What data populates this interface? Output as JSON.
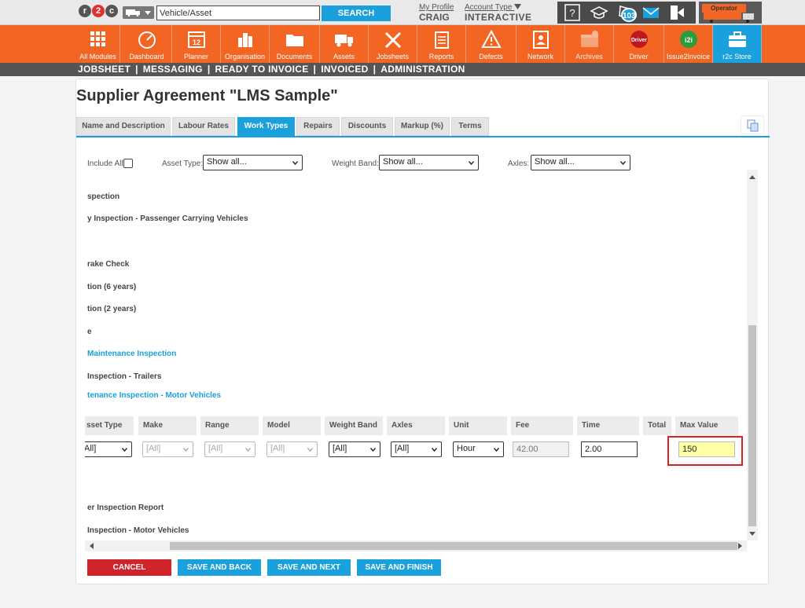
{
  "topbar": {
    "search_placeholder": "Vehicle/Asset",
    "search_button": "SEARCH",
    "profile_link": "My Profile",
    "profile_name": "CRAIG",
    "account_link": "Account Type",
    "account_value": "INTERACTIVE",
    "notification_count": "103",
    "operator_label": "Operator"
  },
  "modules": [
    {
      "label": "All Modules",
      "icon": "grid-icon"
    },
    {
      "label": "Dashboard",
      "icon": "speedometer-icon"
    },
    {
      "label": "Planner",
      "icon": "calendar-icon"
    },
    {
      "label": "Organisation",
      "icon": "building-icon"
    },
    {
      "label": "Documents",
      "icon": "folder-icon"
    },
    {
      "label": "Assets",
      "icon": "truck-icon"
    },
    {
      "label": "Jobsheets",
      "icon": "tools-icon"
    },
    {
      "label": "Reports",
      "icon": "clipboard-icon"
    },
    {
      "label": "Defects",
      "icon": "warning-icon"
    },
    {
      "label": "Network",
      "icon": "contacts-icon"
    },
    {
      "label": "Archives",
      "icon": "archive-icon"
    },
    {
      "label": "Driver",
      "icon": "driver-icon",
      "icon_text": "Driver"
    },
    {
      "label": "Issue2Invoice",
      "icon": "i2i-icon",
      "icon_text": "i2i"
    },
    {
      "label": "r2c Store",
      "icon": "briefcase-icon"
    }
  ],
  "nav": [
    "JOBSHEET",
    "MESSAGING",
    "READY TO INVOICE",
    "INVOICED",
    "ADMINISTRATION"
  ],
  "page": {
    "title": "Supplier Agreement \"LMS Sample\""
  },
  "tabs": [
    {
      "label": "Name and Description"
    },
    {
      "label": "Labour Rates"
    },
    {
      "label": "Work Types",
      "active": true
    },
    {
      "label": "Repairs"
    },
    {
      "label": "Discounts"
    },
    {
      "label": "Markup (%)"
    },
    {
      "label": "Terms"
    }
  ],
  "filters": {
    "include_all_label": "Include All",
    "asset_type_label": "Asset Type:",
    "asset_type_value": "Show all...",
    "weight_band_label": "Weight Band:",
    "weight_band_value": "Show all...",
    "axles_label": "Axles:",
    "axles_value": "Show all..."
  },
  "work_types": [
    {
      "text": "spection",
      "blue": false
    },
    {
      "text": "y Inspection - Passenger Carrying Vehicles",
      "blue": false
    },
    {
      "text": "rake Check",
      "blue": false
    },
    {
      "text": "tion (6 years)",
      "blue": false
    },
    {
      "text": "tion (2 years)",
      "blue": false
    },
    {
      "text": "e",
      "blue": false
    },
    {
      "text": "Maintenance Inspection",
      "blue": true
    },
    {
      "text": "Inspection - Trailers",
      "blue": false
    },
    {
      "text": "tenance Inspection - Motor Vehicles",
      "blue": true
    },
    {
      "text": "er Inspection Report",
      "blue": false
    },
    {
      "text": "Inspection - Motor Vehicles",
      "blue": false
    }
  ],
  "grid": {
    "headers": [
      "sset Type",
      "Make",
      "Range",
      "Model",
      "Weight Band",
      "Axles",
      "Unit",
      "Fee",
      "Time",
      "Total",
      "Max Value"
    ],
    "row": {
      "asset_type": "All]",
      "make": "[All]",
      "range": "[All]",
      "model": "[All]",
      "weight_band": "[All]",
      "axles": "[All]",
      "unit": "Hour",
      "fee": "42.00",
      "time": "2.00",
      "max_value": "150"
    }
  },
  "buttons": {
    "cancel": "CANCEL",
    "save_back": "SAVE AND BACK",
    "save_next": "SAVE AND NEXT",
    "save_finish": "SAVE AND FINISH"
  },
  "colors": {
    "brand_orange": "#f26522",
    "accent_blue": "#1aa0dc",
    "cancel_red": "#d0232a",
    "highlight_yellow": "#ffffa8"
  }
}
